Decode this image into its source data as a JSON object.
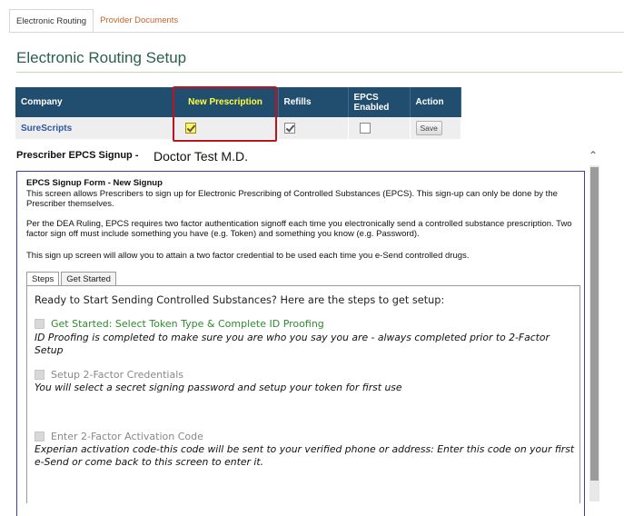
{
  "top_tabs": [
    {
      "label": "Electronic Routing"
    },
    {
      "label": "Provider Documents"
    }
  ],
  "page_title": "Electronic Routing Setup",
  "routing_table": {
    "headers": {
      "company": "Company",
      "new_prescription": "New Prescription",
      "refills": "Refills",
      "epcs_line1": "EPCS",
      "epcs_line2": "Enabled",
      "action": "Action"
    },
    "row": {
      "company": "SureScripts",
      "new_prescription_checked": true,
      "refills_checked": true,
      "epcs_enabled_checked": false,
      "action_label": "Save"
    }
  },
  "signup": {
    "heading": "Prescriber EPCS Signup -",
    "prescriber_name": "Doctor Test M.D."
  },
  "form": {
    "title": "EPCS Signup Form - New Signup",
    "para1": "This screen allows Prescribers to sign up for Electronic Prescribing of Controlled Substances (EPCS). This sign-up can only be done by the Prescriber themselves.",
    "para2": "Per the DEA Ruling, EPCS requires two factor authentication signoff each time you electronically send a controlled substance prescription. Two factor sign off must include something you have (e.g. Token) and something you know (e.g. Password).",
    "para3": "This sign up screen will allow you to attain a two factor credential to be used each time you e-Send controlled drugs.",
    "tabs": [
      {
        "label": "Steps"
      },
      {
        "label": "Get Started"
      }
    ],
    "steps_intro": "Ready to Start Sending Controlled Substances? Here are the steps to get setup:",
    "steps": [
      {
        "title": "Get Started: Select Token Type & Complete ID Proofing",
        "desc": "ID Proofing is completed to make sure you are who you say you are - always completed prior to 2-Factor Setup"
      },
      {
        "title": "Setup 2-Factor Credentials",
        "desc": "You will select a secret signing password and setup your token for first use"
      },
      {
        "title": "Enter 2-Factor Activation Code",
        "desc": "Experian activation code-this code will be sent to your verified phone or address: Enter this code on your first e-Send or come back to this screen to enter it."
      }
    ]
  },
  "colors": {
    "header_bg": "#214e6e",
    "highlight_yellow": "#ffff3a",
    "annotation_red": "#c1121f",
    "title_green": "#2c5f4c",
    "step_green": "#2e8b2e"
  }
}
